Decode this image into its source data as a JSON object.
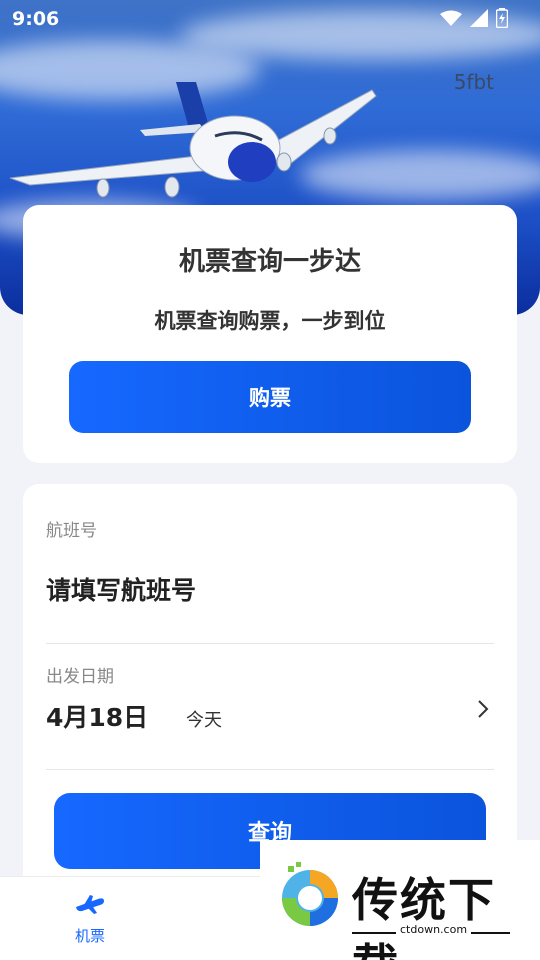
{
  "status_bar": {
    "time": "9:06"
  },
  "header": {
    "corner_tag": "5fbt"
  },
  "promo_card": {
    "title": "机票查询一步达",
    "subtitle": "机票查询购票，一步到位",
    "buy_label": "购票"
  },
  "search_card": {
    "flight_label": "航班号",
    "flight_placeholder": "请填写航班号",
    "date_label": "出发日期",
    "date_value": "4月18日",
    "date_hint": "今天",
    "query_label": "查询"
  },
  "tab_bar": {
    "items": [
      {
        "label": "机票",
        "icon": "airplane-icon",
        "active": true
      },
      {
        "label": "",
        "icon": "document-icon",
        "active": false
      }
    ],
    "active_color": "#1668ff"
  },
  "watermark": {
    "title": "传统下载",
    "domain": "ctdown.com"
  },
  "colors": {
    "accent": "#1668ff",
    "background": "#f2f3f8"
  }
}
